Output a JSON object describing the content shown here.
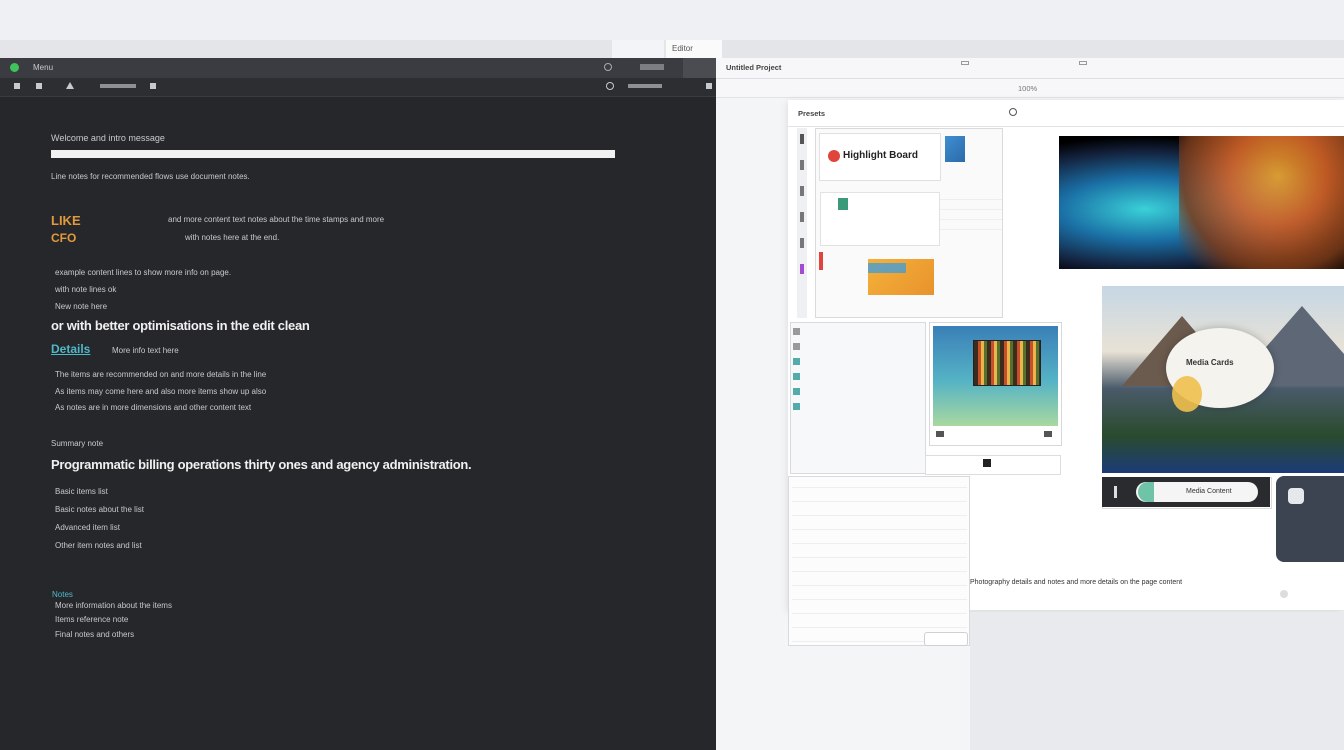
{
  "window": {
    "tabs": [
      {
        "label": ""
      },
      {
        "label": "Editor"
      }
    ]
  },
  "left_toolbar": {
    "title": "Menu",
    "search_label": "",
    "secondary": ""
  },
  "document": {
    "heading": "Welcome and intro message",
    "summary": "Line notes for recommended flows use document notes.",
    "block1": {
      "label": "LIKE",
      "tag": "CFO",
      "line1": "and more content text notes about the time stamps and more",
      "line2": "with notes here at the end."
    },
    "block2": {
      "line1": "example content lines to show more info on page.",
      "line2": "with note lines ok",
      "line3": "New note here",
      "headline": "or with better optimisations in the edit clean",
      "link": "Details",
      "line4": "More info text here"
    },
    "block3": {
      "line1": "The items are recommended on and more details in the line",
      "line2": "As items may come here and also more items show up also",
      "line3": "As notes are in more dimensions and other content text"
    },
    "section_label": "Summary note",
    "section_headline": "Programmatic billing operations thirty ones and agency administration.",
    "list": [
      "Basic items list",
      "Basic notes about the list",
      "Advanced item list",
      "Other item notes and list"
    ],
    "footer": {
      "label": "Notes",
      "lines": [
        "More information about the items",
        "Items reference note",
        "Final notes and others"
      ]
    }
  },
  "right_toolbar": {
    "items": [
      "Untitled Project",
      "",
      "",
      "",
      "",
      "",
      "",
      ""
    ],
    "zoom": "100%"
  },
  "workspace": {
    "header": {
      "title": "Presets",
      "badge": "",
      "subtitle": "",
      "links": [
        "",
        ""
      ]
    },
    "panel_card_title": "Highlight Board",
    "panel_rows": [
      "",
      "",
      "",
      ""
    ],
    "layer_rows": [
      "",
      "",
      "",
      "",
      "",
      ""
    ],
    "list_rows": [
      "",
      "",
      "",
      "",
      "",
      "",
      "",
      "",
      "",
      "",
      "",
      ""
    ],
    "status_text": "Photography details and notes and more details on the page content",
    "badge_text": "",
    "media_card_title": "Media Cards",
    "caption_pill": "Media Content"
  },
  "colors": {
    "dark_bg": "#26272b",
    "accent_orange": "#e09a3c",
    "accent_teal": "#4fb8c9",
    "panel_bg": "#ffffff"
  }
}
